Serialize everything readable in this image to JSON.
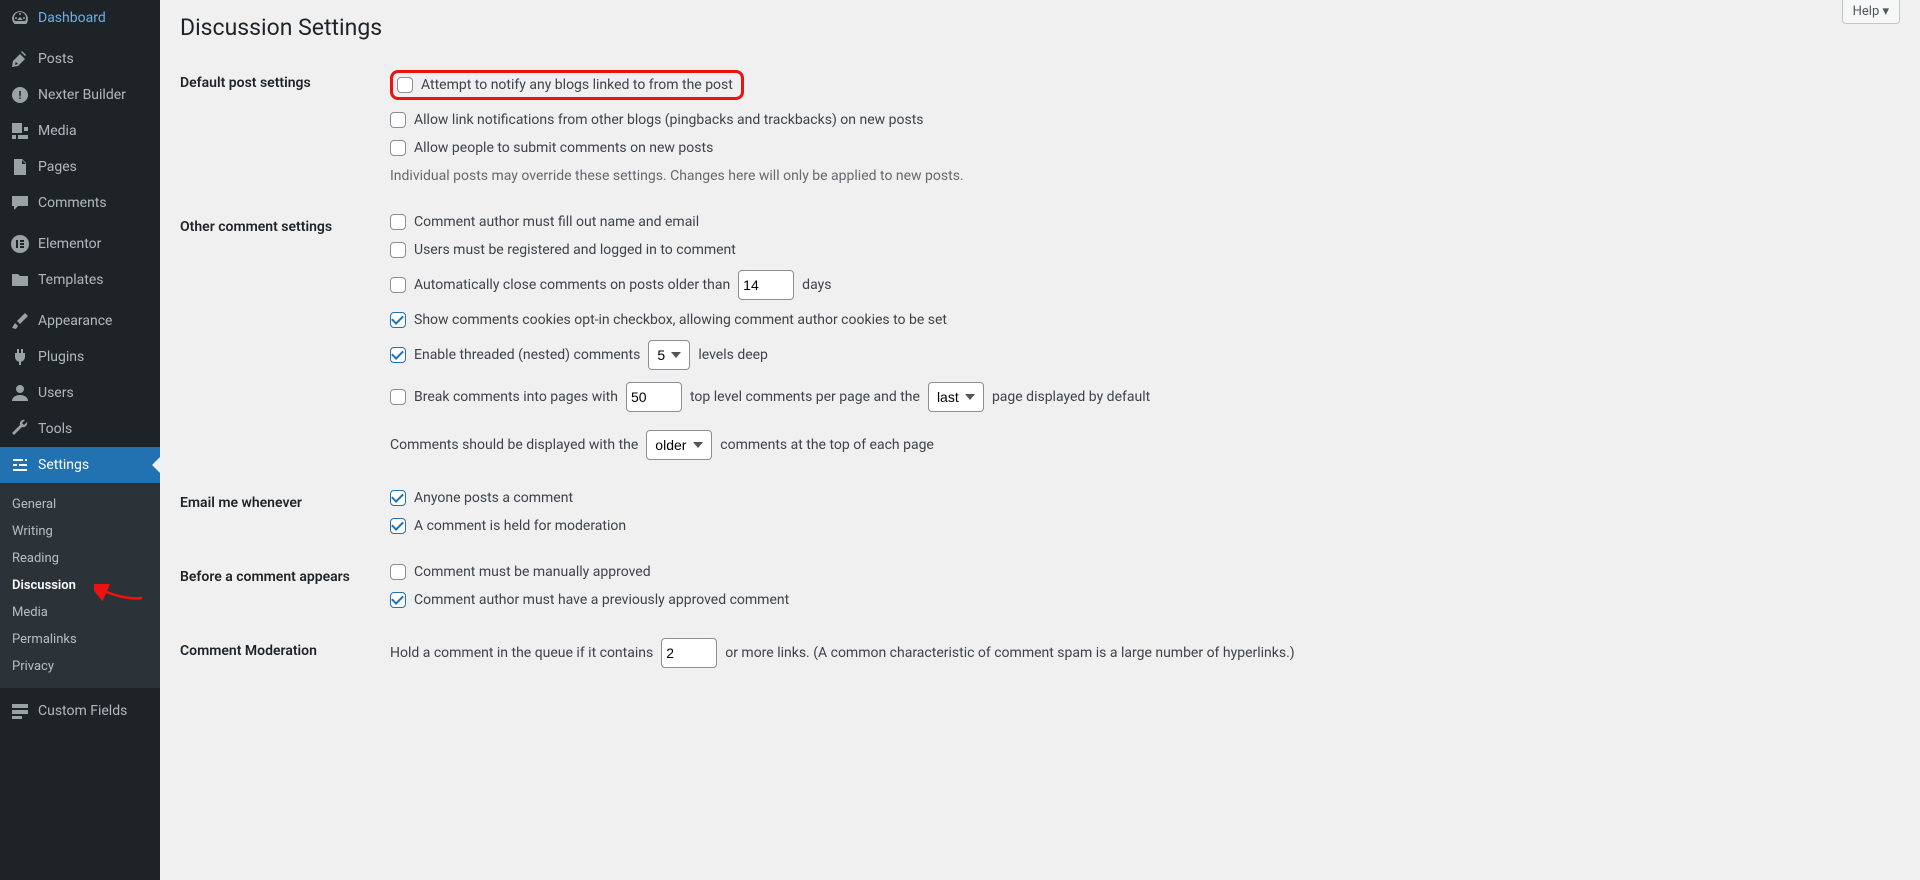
{
  "sidebar": {
    "items": [
      {
        "label": "Dashboard"
      },
      {
        "label": "Posts"
      },
      {
        "label": "Nexter Builder"
      },
      {
        "label": "Media"
      },
      {
        "label": "Pages"
      },
      {
        "label": "Comments"
      },
      {
        "label": "Elementor"
      },
      {
        "label": "Templates"
      },
      {
        "label": "Appearance"
      },
      {
        "label": "Plugins"
      },
      {
        "label": "Users"
      },
      {
        "label": "Tools"
      },
      {
        "label": "Settings"
      },
      {
        "label": "Custom Fields"
      }
    ],
    "submenu": [
      {
        "label": "General"
      },
      {
        "label": "Writing"
      },
      {
        "label": "Reading"
      },
      {
        "label": "Discussion"
      },
      {
        "label": "Media"
      },
      {
        "label": "Permalinks"
      },
      {
        "label": "Privacy"
      }
    ]
  },
  "help_label": "Help ▾",
  "page_title": "Discussion Settings",
  "sections": {
    "default_post": {
      "heading": "Default post settings",
      "opt1": "Attempt to notify any blogs linked to from the post",
      "opt2": "Allow link notifications from other blogs (pingbacks and trackbacks) on new posts",
      "opt3": "Allow people to submit comments on new posts",
      "note": "Individual posts may override these settings. Changes here will only be applied to new posts."
    },
    "other": {
      "heading": "Other comment settings",
      "opt1": "Comment author must fill out name and email",
      "opt2": "Users must be registered and logged in to comment",
      "opt3_pre": "Automatically close comments on posts older than",
      "opt3_days_value": "14",
      "opt3_post": "days",
      "opt4": "Show comments cookies opt-in checkbox, allowing comment author cookies to be set",
      "opt5_pre": "Enable threaded (nested) comments",
      "opt5_select": "5",
      "opt5_post": "levels deep",
      "opt6_pre": "Break comments into pages with",
      "opt6_value": "50",
      "opt6_mid": "top level comments per page and the",
      "opt6_select": "last",
      "opt6_post": "page displayed by default",
      "opt7_pre": "Comments should be displayed with the",
      "opt7_select": "older",
      "opt7_post": "comments at the top of each page"
    },
    "email": {
      "heading": "Email me whenever",
      "opt1": "Anyone posts a comment",
      "opt2": "A comment is held for moderation"
    },
    "before": {
      "heading": "Before a comment appears",
      "opt1": "Comment must be manually approved",
      "opt2": "Comment author must have a previously approved comment"
    },
    "moderation": {
      "heading": "Comment Moderation",
      "pre": "Hold a comment in the queue if it contains",
      "value": "2",
      "post": "or more links. (A common characteristic of comment spam is a large number of hyperlinks.)"
    }
  }
}
